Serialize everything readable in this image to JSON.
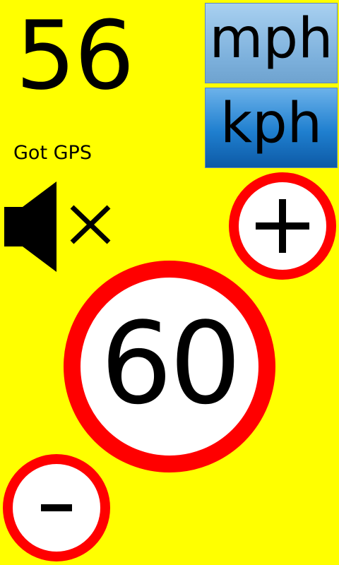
{
  "current_speed": "56",
  "gps_status": "Got GPS",
  "units": {
    "mph_label": "mph",
    "kph_label": "kph"
  },
  "sound": {
    "icon": "speaker-muted-icon",
    "state": "muted"
  },
  "speed_limit": {
    "value": "60",
    "increase_icon": "plus-icon",
    "decrease_icon": "minus-icon"
  },
  "colors": {
    "background": "#ffff00",
    "sign_ring": "#ff0000",
    "sign_face": "#ffffff",
    "mph_button": "#7cb0dc",
    "kph_button": "#1f7fcf"
  }
}
